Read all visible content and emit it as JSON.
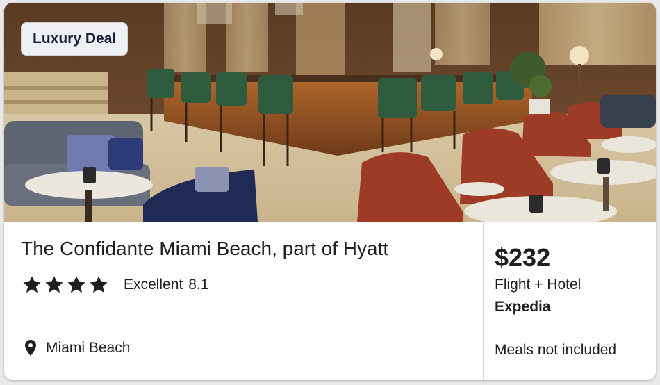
{
  "card": {
    "badge": "Luxury Deal",
    "photo_alt": "hotel lounge bar",
    "hotel_name": "The Confidante Miami Beach, part of Hyatt",
    "rating": {
      "stars": 4,
      "label": "Excellent",
      "score": "8.1"
    },
    "location": "Miami Beach",
    "price": "$232",
    "package": "Flight + Hotel",
    "provider": "Expedia",
    "meals": "Meals not included"
  },
  "icons": {
    "star": "star-icon",
    "location": "location-pin-icon"
  },
  "colors": {
    "text": "#1f1f1f",
    "badge_bg": "#eef0f3",
    "badge_text": "#191e3b"
  }
}
